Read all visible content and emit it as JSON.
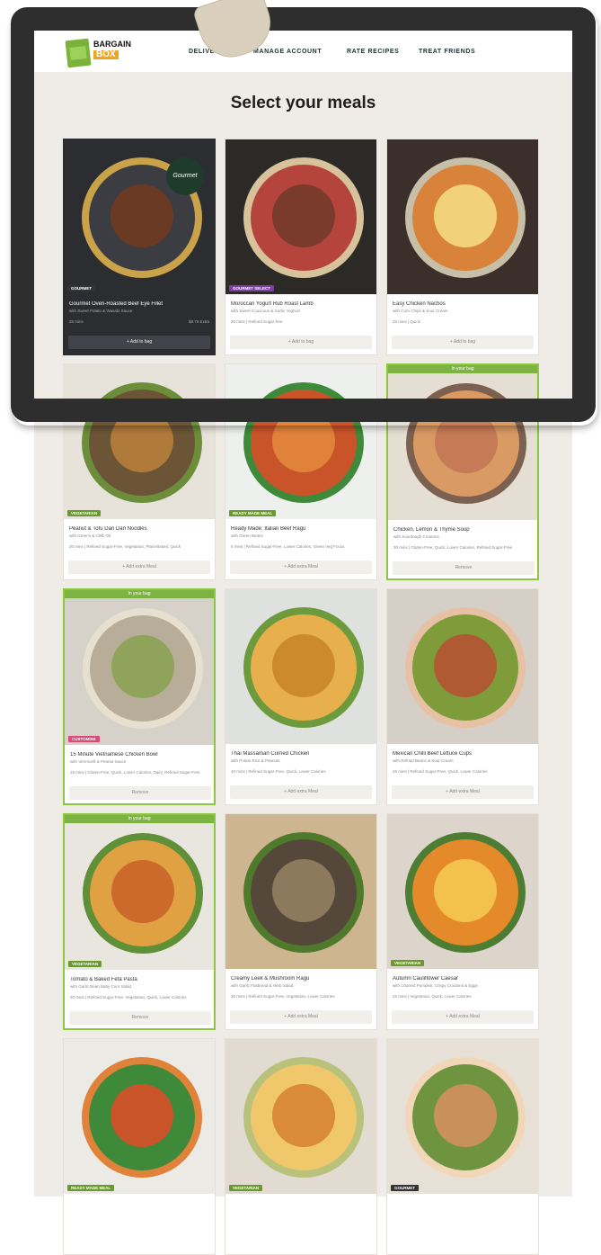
{
  "brand": {
    "line1": "BARGAIN",
    "line2": "BOX"
  },
  "nav": [
    "DELIVERY",
    "MANAGE ACCOUNT",
    "RATE RECIPES",
    "TREAT FRIENDS"
  ],
  "title": "Select your meals",
  "cards": [
    {
      "name": "Gourmet Oven-Roasted Beef Eye Fillet",
      "sub": "with Sweet Potato & Wasabi Sauce",
      "meta": "25 mins",
      "price": "$8.75 Extra",
      "button": "+ Add to bag",
      "tag": "GOURMET",
      "badge": "Gourmet",
      "in_bag": false
    },
    {
      "name": "Moroccan Yogurt Rub Roast Lamb",
      "sub": "with Sweet Couscous & Garlic Yoghurt",
      "meta": "30 mins | Refined Sugar-free",
      "button": "+ Add to bag",
      "tag": "GOURMET SELECT",
      "in_bag": false
    },
    {
      "name": "Easy Chicken Nachos",
      "sub": "with Corn Chips & Sour Cream",
      "meta": "25 mins | Quick",
      "button": "+ Add to bag",
      "tag": "",
      "in_bag": false
    },
    {
      "name": "Peanut & Tofu Dan Dan Noodles",
      "sub": "with Greens & Chilli Oil",
      "meta": "30 mins | Refined Sugar-Free, Vegetarian, Plant-Based, Quick",
      "button": "+ Add extra Meal",
      "tag": "VEGETARIAN",
      "in_bag": false
    },
    {
      "name": "Ready Made: Italian Beef Ragu",
      "sub": "with Green Beans",
      "meta": "5 mins | Refined Sugar-Free, Lower Calories, Green Veg Focus",
      "button": "+ Add extra Meal",
      "tag": "READY MADE MEAL",
      "in_bag": false
    },
    {
      "name": "Chicken, Lemon & Thyme Soup",
      "sub": "with Sourdough Croutons",
      "meta": "30 mins | Gluten-Free, Quick, Lower Calories, Refined Sugar-Free",
      "button": "Remove",
      "tag": "",
      "in_bag": true
    },
    {
      "name": "15 Minute Vietnamese Chicken Bowl",
      "sub": "with Vermicelli & Peanut Sauce",
      "meta": "15 mins | Gluten-Free, Quick, Lower Calories, Dairy, Refined Sugar-Free",
      "button": "Remove",
      "tag": "CUSTOMISE",
      "in_bag": true
    },
    {
      "name": "Thai Massaman Curried Chicken",
      "sub": "with Potato Rice & Peanuts",
      "meta": "40 mins | Refined Sugar-Free, Quick, Lower Calories",
      "button": "+ Add extra Meal",
      "tag": "",
      "in_bag": false
    },
    {
      "name": "Mexican Chilli Beef Lettuce Cups",
      "sub": "with Refried Beans & Sour Cream",
      "meta": "25 mins | Refined Sugar-Free, Quick, Lower Calories",
      "button": "+ Add extra Meal",
      "tag": "",
      "in_bag": false
    },
    {
      "name": "Tomato & Baked Feta Pasta",
      "sub": "with Garlic Bean Baby Corn Salad",
      "meta": "30 mins | Refined Sugar-Free, Vegetarian, Quick, Lower Calories",
      "button": "Remove",
      "tag": "VEGETARIAN",
      "in_bag": true
    },
    {
      "name": "Creamy Leek & Mushroom Ragu",
      "sub": "with Garlic Flatbread & Herb Salad",
      "meta": "30 mins | Refined Sugar-Free, Vegetarian, Lower Calories",
      "button": "+ Add extra Meal",
      "tag": "",
      "in_bag": false
    },
    {
      "name": "Autumn Cauliflower Caesar",
      "sub": "with Charred Pumpkin, Crispy Croutons & Eggs",
      "meta": "25 mins | Vegetarian, Quick, Lower Calories",
      "button": "+ Add extra Meal",
      "tag": "VEGETARIAN",
      "in_bag": false
    },
    {
      "name": "",
      "sub": "",
      "meta": "",
      "button": "",
      "tag": "READY MADE MEAL",
      "in_bag": false
    },
    {
      "name": "",
      "sub": "",
      "meta": "",
      "button": "",
      "tag": "VEGETARIAN",
      "in_bag": false
    },
    {
      "name": "",
      "sub": "",
      "meta": "",
      "button": "",
      "tag": "GOURMET",
      "in_bag": false
    }
  ],
  "in_bag_label": "In your bag",
  "colors": {
    "accent": "#7cb342",
    "bg": "#efece7",
    "dark_card": "#2b2d31",
    "tag_green": "#6a9a2f",
    "tag_purple": "#7b3fa0",
    "tag_pink": "#e0487a",
    "tag_blue": "#2e72c8"
  }
}
